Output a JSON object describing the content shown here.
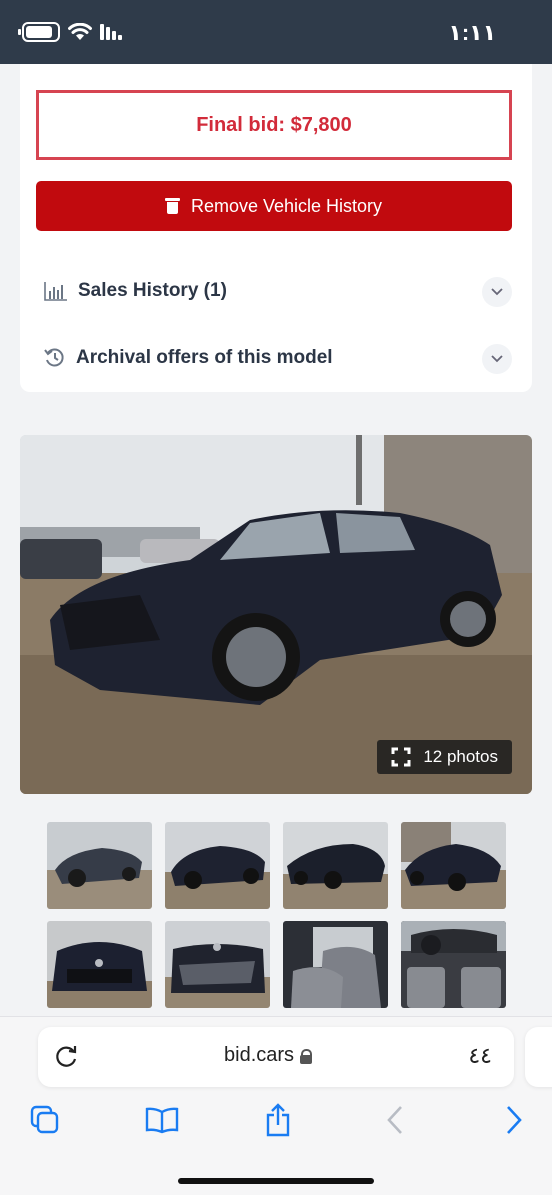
{
  "status_bar": {
    "time": "١:١١"
  },
  "auction": {
    "final_bid": "Final bid: $7,800",
    "remove_button": "Remove Vehicle History",
    "sales_history": "Sales History (1)",
    "archival_offers": "Archival offers of this model"
  },
  "gallery": {
    "photos_count": "12 photos",
    "thumbnails": [
      "photo 1",
      "photo 2",
      "photo 3",
      "photo 4",
      "photo 5",
      "photo 6",
      "photo 7",
      "photo 8"
    ]
  },
  "browser": {
    "domain": "bid.cars",
    "text_size": "٤٤"
  },
  "colors": {
    "accent_red": "#c10a0e",
    "bid_red": "#d22b3a",
    "ios_blue": "#1a7cf2"
  },
  "icons": [
    "battery-icon",
    "wifi-icon",
    "signal-icon",
    "trash-icon",
    "chart-icon",
    "history-icon",
    "chevron-down-icon",
    "expand-icon",
    "reload-icon",
    "lock-icon",
    "tabs-icon",
    "bookmarks-icon",
    "share-icon",
    "back-icon",
    "forward-icon"
  ]
}
